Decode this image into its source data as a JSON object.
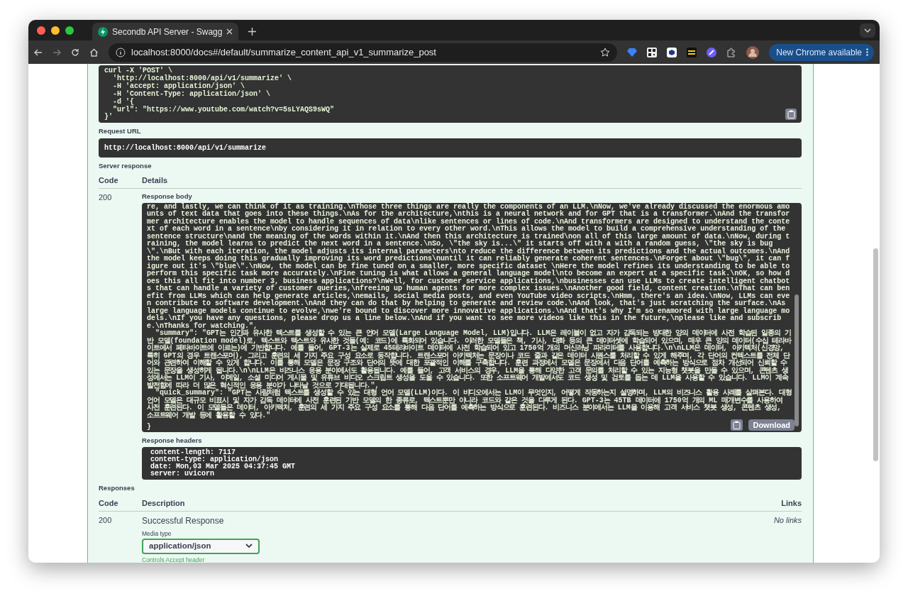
{
  "browser": {
    "tab_title": "Secondb API Server - Swagg",
    "url": "localhost:8000/docs#/default/summarize_content_api_v1_summarize_post",
    "update_button": "New Chrome available"
  },
  "curl": {
    "lines": [
      "curl -X 'POST' \\",
      "  'http://localhost:8000/api/v1/summarize' \\",
      "  -H 'accept: application/json' \\",
      "  -H 'Content-Type: application/json' \\",
      "  -d '{",
      "  \"url\": \"https://www.youtube.com/watch?v=5sLYAQS9sWQ\"",
      "}'"
    ]
  },
  "request_url": {
    "label": "Request URL",
    "value": "http://localhost:8000/api/v1/summarize"
  },
  "server_response": {
    "label": "Server response",
    "columns": [
      "Code",
      "Details"
    ],
    "code": "200",
    "body_label": "Response body",
    "body_lines": [
      "re, and lastly, we can think of it as training.\\nThose three things are really the components of an LLM.\\nNow, we've already discussed the enormous amounts of text data that goes into these things.\\nAs for the architecture,\\nthis is a neural network and for GPT that is a transformer.\\nAnd the transformer architecture enables the model to handle sequences of data\\nlike sentences or lines of code.\\nAnd transformers are designed to understand the context of each word in a sentence\\nby considering it in relation to every other word.\\nThis allows the model to build a comprehensive understanding of the sentence structure\\nand the meaning of the words within it.\\nAnd then this architecture is trained\\non all of this large amount of data.\\nNow, during training, the model learns to predict the next word in a sentence.\\nSo, \\\"the sky is...\\\" it starts off with a with a random guess, \\\"the sky is bug\\\".\\nBut with each iteration, the model adjusts its internal parameters\\nto reduce the difference between its predictions and the actual outcomes.\\nAnd the model keeps doing this gradually improving its word predictions\\nuntil it can reliably generate coherent sentences.\\nForget about \\\"bug\\\", it can figure out it's \\\"blue\\\".\\nNow, the model can be fine tuned on a smaller, more specific dataset \\nHere the model refines its understanding to be able to perform this specific task more accurately.\\nFine tuning is what allows a general language model\\nto become an expert at a specific task.\\nOK, so how does this all fit into number 3, business applications?\\nWell, for customer service applications,\\nbusinesses can use LLMs to create intelligent chatbots that can handle a variety of customer queries,\\nfreeing up human agents for more complex issues.\\nAnother good field, content creation.\\nThat can benefit from LLMs which can help generate articles,\\nemails, social media posts, and even YouTube video scripts.\\nHmm, there's an idea.\\nNow, LLMs can even contribute to software development.\\nAnd they can do that by helping to generate and review code.\\nAnd look, that's just scratching the surface.\\nAs large language models continue to evolve,\\nwe're bound to discover more innovative applications.\\nAnd that's why I'm so enamored with large language models.\\nIf you have any questions, please drop us a line below.\\nAnd if you want to see more videos like this in the future,\\nplease like and subscribe.\\nThanks for watching.\",",
      "  \"summary\": \"GPT는 인간과 유사한 텍스트를 생성할 수 있는 큰 언어 모델(Large Language Model, LLM)입니다. LLM은 레이블이 없고 자가 감독되는 방대한 양의 데이터에 사전 학습된 일종의 기반 모델(foundation model)로, 텍스트와 텍스트와 유사한 것들(예: 코드)에 특화되어 있습니다. 이러한 모델들은 책, 기사, 대화 등의 큰 데이터셋에 학습되어 있으며, 매우 큰 양의 데이터(수십 테라바이트에서 페타바이트에 이르는)에 기반합니다. 예를 들어, GPT-3는 실제로 45테라바이트 데이터에 사전 학습되어 있고 1750억 개의 머신러닝 파라미터를 사용합니다.\\n\\nLLM은 데이터, 아키텍처(신경망, 특히 GPT의 경우 트랜스포머), 그리고 훈련의 세 가지 주요 구성 요소로 동작합니다. 트랜스포머 아키텍처는 문장이나 코드 줄과 같은 데이터 시퀀스를 처리할 수 있게 해주며, 각 단어의 컨텍스트를 전체 단어와 관련하여 이해할 수 있게 합니다. 이를 통해 모델은 문장 구조와 단어의 뜻에 대한 포괄적인 이해를 구축합니다. 훈련 과정에서 모델은 문장에서 다음 단어를 예측하는 방식으로 점차 개선되어 신뢰할 수 있는 문장을 생성하게 됩니다.\\n\\nLLM은 비즈니스 응용 분야에서도 활용됩니다. 예를 들어, 고객 서비스의 경우, LLM을 통해 다양한 고객 문의를 처리할 수 있는 지능형 챗봇을 만들 수 있으며, 콘텐츠 생성에서는 LLM이 기사, 이메일, 소셜 미디어 게시물 및 유튜브 비디오 스크립트 생성을 도울 수 있습니다. 또한 소프트웨어 개발에서도 코드 생성 및 검토를 돕는 데 LLM을 사용할 수 있습니다. LLM이 계속 발전함에 따라 더 많은 혁신적인 응용 분야가 나타날 것으로 기대됩니다.\",",
      "  \"quick_summary\": \"GPT는 사람처럼 텍스트를 생성할 수 있는 대형 언어 모델(LLM)이다. 이 비디오에서는 LLM이 무엇인지, 어떻게 작동하는지 설명하며, LLM의 비즈니스 활용 사례를 살펴본다. 대형 언어 모델은 대규모 비표시 및 자가 감독 데이터에 사전 훈련된 기반 모델의 한 종류로, 텍스트뿐만 아니라 코드와 같은 것을 다루게 된다. GPT-3는 45TB 데이터에 1750억 개의 ML 매개변수를 사용하여 사전 훈련된다. 이 모델들은 데이터, 아키텍처, 훈련의 세 가지 주요 구성 요소를 통해 다음 단어를 예측하는 방식으로 훈련된다. 비즈니스 분야에서는 LLM을 이용해 고객 서비스 챗봇 생성, 콘텐츠 생성, 소프트웨어 개발 등에 활용할 수 있다.\"",
      "}"
    ],
    "download_button": "Download",
    "headers_label": "Response headers",
    "headers": [
      "content-length: 7117",
      "content-type: application/json",
      "date: Mon,03 Mar 2025 04:37:45 GMT",
      "server: uvicorn"
    ]
  },
  "responses": {
    "label": "Responses",
    "columns": [
      "Code",
      "Description",
      "Links"
    ],
    "rows": [
      {
        "code": "200",
        "description": "Successful Response",
        "links": "No links",
        "media_type_label": "Media type",
        "media_type": "application/json",
        "controls_note": "Controls Accept header"
      }
    ]
  }
}
